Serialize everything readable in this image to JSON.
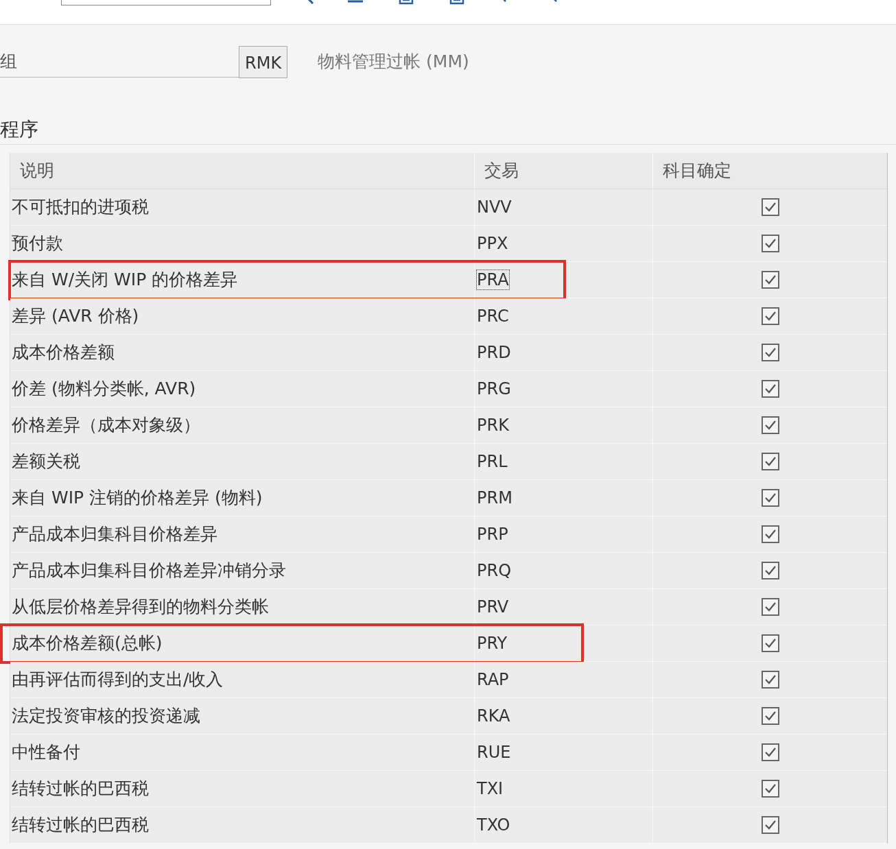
{
  "group": {
    "label": "组",
    "value": "RMK",
    "description": "物料管理过帐 (MM)"
  },
  "section": {
    "title": "程序"
  },
  "table": {
    "columns": [
      "说明",
      "交易",
      "科目确定"
    ],
    "rows": [
      {
        "description": "不可抵扣的进项税",
        "transaction": "NVV",
        "checked": true,
        "highlighted": false,
        "focused": false
      },
      {
        "description": "预付款",
        "transaction": "PPX",
        "checked": true,
        "highlighted": false,
        "focused": false
      },
      {
        "description": "来自 W/关闭 WIP 的价格差异",
        "transaction": "PRA",
        "checked": true,
        "highlighted": true,
        "focused": true
      },
      {
        "description": "差异 (AVR 价格)",
        "transaction": "PRC",
        "checked": true,
        "highlighted": false,
        "focused": false
      },
      {
        "description": "成本价格差额",
        "transaction": "PRD",
        "checked": true,
        "highlighted": false,
        "focused": false
      },
      {
        "description": "价差 (物料分类帐, AVR)",
        "transaction": "PRG",
        "checked": true,
        "highlighted": false,
        "focused": false
      },
      {
        "description": "价格差异（成本对象级）",
        "transaction": "PRK",
        "checked": true,
        "highlighted": false,
        "focused": false
      },
      {
        "description": "差额关税",
        "transaction": "PRL",
        "checked": true,
        "highlighted": false,
        "focused": false
      },
      {
        "description": "来自 WIP 注销的价格差异 (物料)",
        "transaction": "PRM",
        "checked": true,
        "highlighted": false,
        "focused": false
      },
      {
        "description": "产品成本归集科目价格差异",
        "transaction": "PRP",
        "checked": true,
        "highlighted": false,
        "focused": false
      },
      {
        "description": "产品成本归集科目价格差异冲销分录",
        "transaction": "PRQ",
        "checked": true,
        "highlighted": false,
        "focused": false
      },
      {
        "description": "从低层价格差异得到的物料分类帐",
        "transaction": "PRV",
        "checked": true,
        "highlighted": false,
        "focused": false
      },
      {
        "description": "成本价格差额(总帐)",
        "transaction": "PRY",
        "checked": true,
        "highlighted": true,
        "focused": false
      },
      {
        "description": "由再评估而得到的支出/收入",
        "transaction": "RAP",
        "checked": true,
        "highlighted": false,
        "focused": false
      },
      {
        "description": "法定投资审核的投资递减",
        "transaction": "RKA",
        "checked": true,
        "highlighted": false,
        "focused": false
      },
      {
        "description": "中性备付",
        "transaction": "RUE",
        "checked": true,
        "highlighted": false,
        "focused": false
      },
      {
        "description": "结转过帐的巴西税",
        "transaction": "TXI",
        "checked": true,
        "highlighted": false,
        "focused": false
      },
      {
        "description": "结转过帐的巴西税",
        "transaction": "TXO",
        "checked": true,
        "highlighted": false,
        "focused": false
      }
    ]
  }
}
